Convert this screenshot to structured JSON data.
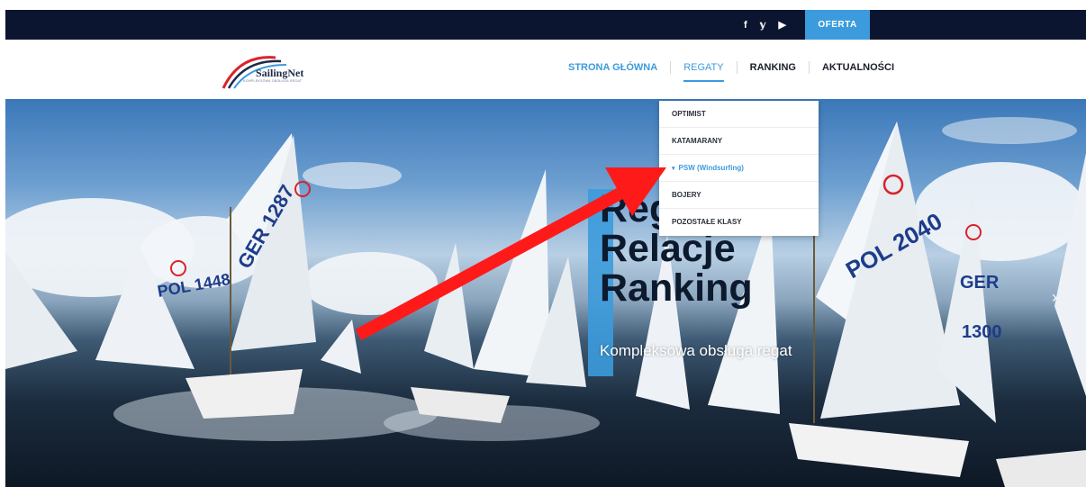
{
  "topbar": {
    "social": [
      {
        "icon": "facebook-icon",
        "glyph": "f"
      },
      {
        "icon": "twitter-icon",
        "glyph": "𝕪"
      },
      {
        "icon": "youtube-icon",
        "glyph": "▶"
      }
    ],
    "offer_label": "OFERTA"
  },
  "header": {
    "logo_text": "SailingNet",
    "logo_sub": "KOMPLEKSOWA OBSŁUGA REGAT",
    "nav": [
      {
        "label": "STRONA GŁÓWNA"
      },
      {
        "label": "REGATY"
      },
      {
        "label": "RANKING"
      },
      {
        "label": "AKTUALNOŚCI"
      }
    ]
  },
  "dropdown": {
    "items": [
      {
        "label": "OPTIMIST"
      },
      {
        "label": "KATAMARANY"
      },
      {
        "label": "PSW (Windsurfing)"
      },
      {
        "label": "BOJERY"
      },
      {
        "label": "POZOSTAŁE KLASY"
      }
    ],
    "active_arrow": "▾"
  },
  "hero": {
    "title_line1": "Regaty",
    "title_line2": "Relacje",
    "title_line3": "Ranking",
    "subtitle": "Kompleksowa obsługa regat",
    "next_arrow": "›"
  },
  "colors": {
    "topbar_bg": "#0c1530",
    "accent": "#3c9bdc",
    "arrow_red": "#ff1a1a"
  }
}
